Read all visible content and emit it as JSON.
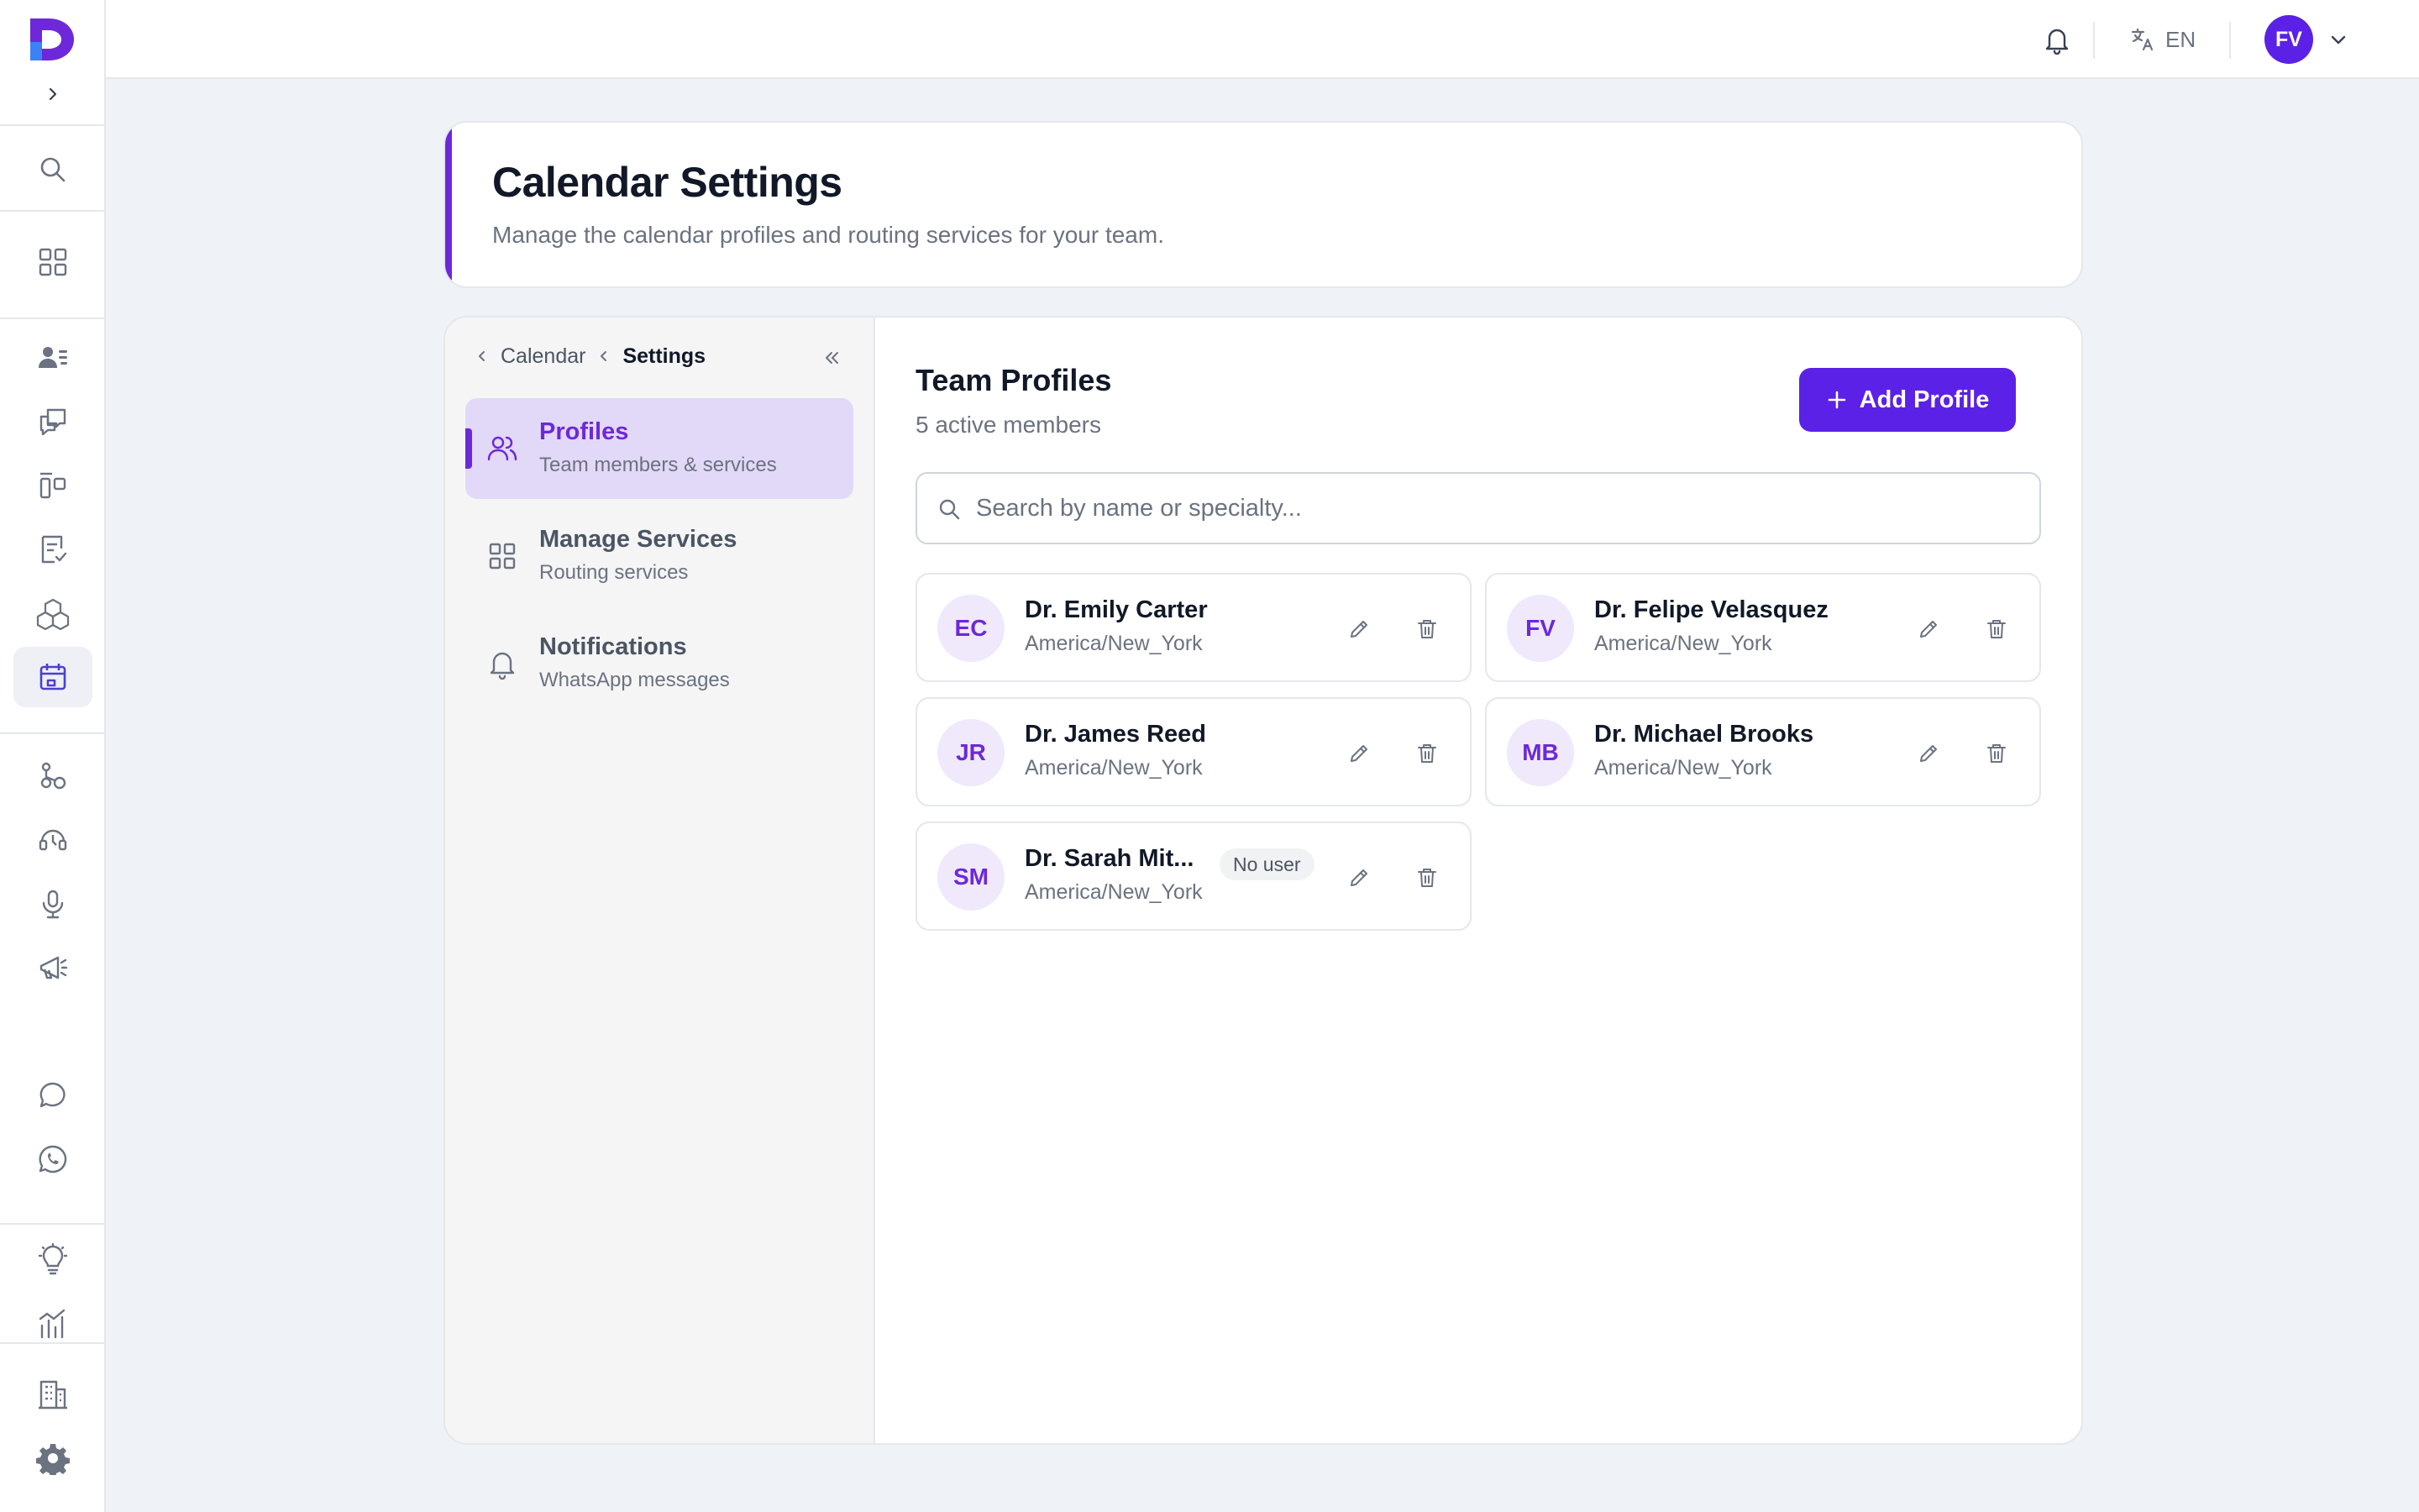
{
  "topbar": {
    "language": "EN",
    "user_initials": "FV"
  },
  "header": {
    "title": "Calendar Settings",
    "subtitle": "Manage the calendar profiles and routing services for your team."
  },
  "breadcrumb": {
    "parent": "Calendar",
    "current": "Settings"
  },
  "settings_nav": [
    {
      "title": "Profiles",
      "subtitle": "Team members & services",
      "icon": "users-icon",
      "active": true
    },
    {
      "title": "Manage Services",
      "subtitle": "Routing services",
      "icon": "grid-icon",
      "active": false
    },
    {
      "title": "Notifications",
      "subtitle": "WhatsApp messages",
      "icon": "bell-icon",
      "active": false
    }
  ],
  "team": {
    "title": "Team Profiles",
    "subtitle": "5 active members",
    "add_label": "Add Profile",
    "search_placeholder": "Search by name or specialty...",
    "profiles": [
      {
        "initials": "EC",
        "name": "Dr. Emily Carter",
        "timezone": "America/New_York",
        "badge": ""
      },
      {
        "initials": "FV",
        "name": "Dr. Felipe Velasquez",
        "timezone": "America/New_York",
        "badge": ""
      },
      {
        "initials": "JR",
        "name": "Dr. James Reed",
        "timezone": "America/New_York",
        "badge": ""
      },
      {
        "initials": "MB",
        "name": "Dr. Michael Brooks",
        "timezone": "America/New_York",
        "badge": ""
      },
      {
        "initials": "SM",
        "name": "Dr. Sarah Mit...",
        "timezone": "America/New_York",
        "badge": "No user"
      }
    ]
  },
  "colors": {
    "brand": "#5b21e6",
    "accent": "#6d28d9",
    "active_nav_bg": "#e2d8f7"
  }
}
